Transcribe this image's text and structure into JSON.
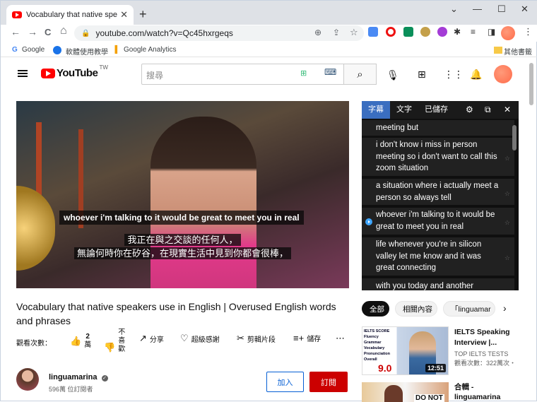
{
  "browser": {
    "tab_title": "Vocabulary that native speaker",
    "tab_close": "✕",
    "new_tab": "+",
    "url": "youtube.com/watch?v=Qc45hxrgeqs",
    "window_controls": [
      "⌄",
      "—",
      "☐",
      "✕"
    ],
    "nav": {
      "back": "←",
      "forward": "→",
      "reload": "C",
      "home": "⌂"
    },
    "bookmarks": [
      {
        "label": "Google",
        "icon": "google-icon"
      },
      {
        "label": "軟體使用教學",
        "icon": "bookmark-icon"
      },
      {
        "label": "Google Analytics",
        "icon": "analytics-icon"
      }
    ],
    "other_bookmarks": "其他書籤"
  },
  "youtube": {
    "logo_text": "YouTube",
    "logo_region": "TW",
    "search_placeholder": "搜尋"
  },
  "video": {
    "caption_en": "whoever i'm talking to it would be great to meet you in real",
    "caption_zh_1": "我正在與之交談的任何人，",
    "caption_zh_2": "無論何時你在矽谷，在現實生活中見到你都會很棒，"
  },
  "transcript": {
    "tabs": [
      "字幕",
      "文字",
      "已儲存"
    ],
    "lines": [
      "meeting but",
      "i don't know i miss in person meeting so i don't want to call this zoom situation",
      "a situation where i actually meet a person so always tell",
      "whoever i'm talking to it would be great to meet you in real",
      "life whenever you're in silicon valley let me know and it was great connecting",
      "with you today and another"
    ],
    "star": "☆"
  },
  "meta": {
    "title": "Vocabulary that native speakers use in English | Overused English words and phrases",
    "views_label": "觀看次數：",
    "likes": "2",
    "likes_unit": "萬",
    "dislike_label": "不喜歡",
    "share": "分享",
    "thanks": "超級感謝",
    "clip": "剪輯片段",
    "save": "儲存",
    "more": "⋯"
  },
  "channel": {
    "name": "linguamarina",
    "subs": "596萬 位訂閱者",
    "join": "加入",
    "subscribe": "訂閱"
  },
  "chips": [
    "全部",
    "相關內容",
    "「linguamar",
    "›"
  ],
  "recs": [
    {
      "thumb_lines": [
        "IELTS SCORE",
        "Fluency",
        "Grammar",
        "Vocabulary",
        "Pronunciation",
        "Overall"
      ],
      "thumb_score": "9.0",
      "duration": "12:51",
      "title": "IELTS Speaking Interview |...",
      "channel": "TOP IELTS TESTS",
      "views": "觀看次數：322萬次・"
    },
    {
      "thumb_text": "DO NOT",
      "title": "合輯 - linguamarina"
    }
  ],
  "colors": {
    "yt_red": "#ff0000",
    "subscribe": "#cc0000",
    "link_blue": "#065fd4",
    "transcript_active": "#3a6ec0"
  }
}
